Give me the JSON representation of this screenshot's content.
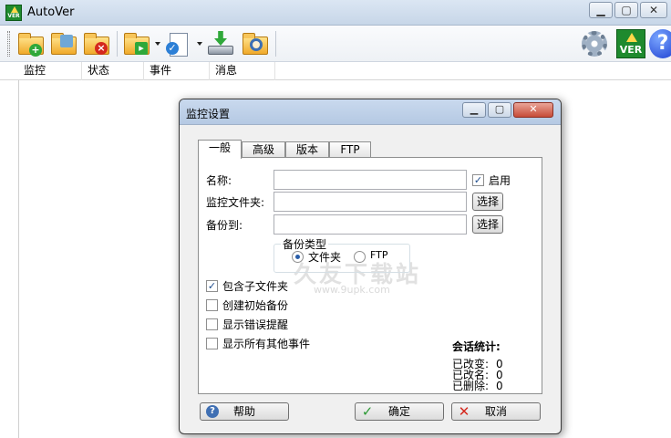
{
  "window": {
    "title": "AutoVer",
    "minimize": "▁",
    "maximize": "▢",
    "close": "✕"
  },
  "toolbar": {
    "buttons": [
      {
        "name": "add-watch",
        "icon": "folder-plus-icon"
      },
      {
        "name": "edit-watch",
        "icon": "folder-edit-icon"
      },
      {
        "name": "delete-watch",
        "icon": "folder-delete-icon"
      },
      {
        "name": "start-watch",
        "icon": "folder-run-icon"
      },
      {
        "name": "view-versions",
        "icon": "document-check-icon"
      },
      {
        "name": "restore",
        "icon": "download-drive-icon"
      },
      {
        "name": "search",
        "icon": "folder-search-icon"
      }
    ],
    "settings_icon": "gear-icon",
    "logo_text": "VER",
    "help_glyph": "?"
  },
  "list": {
    "columns": [
      "监控",
      "状态",
      "事件",
      "消息"
    ]
  },
  "dialog": {
    "title": "监控设置",
    "tabs": [
      "一般",
      "高级",
      "版本",
      "FTP"
    ],
    "active_tab": "一般",
    "name_label": "名称:",
    "name_value": "",
    "enabled_label": "启用",
    "enabled_checked": true,
    "folder_label": "监控文件夹:",
    "folder_value": "",
    "browse_label": "选择",
    "backup_label": "备份到:",
    "backup_value": "",
    "backup_type": {
      "legend": "备份类型",
      "options": [
        "文件夹",
        "FTP"
      ],
      "selected": "文件夹"
    },
    "options": [
      {
        "label": "包含子文件夹",
        "checked": true
      },
      {
        "label": "创建初始备份",
        "checked": false
      },
      {
        "label": "显示错误提醒",
        "checked": false
      },
      {
        "label": "显示所有其他事件",
        "checked": false
      }
    ],
    "stats": {
      "heading": "会话统计:",
      "changed_label": "已改变:",
      "changed_value": "0",
      "renamed_label": "已改名:",
      "renamed_value": "0",
      "deleted_label": "已删除:",
      "deleted_value": "0"
    },
    "buttons": {
      "help": "帮助",
      "ok": "确定",
      "cancel": "取消"
    },
    "watermark": "久友下载站",
    "watermark_sub": "www.9upk.com"
  }
}
